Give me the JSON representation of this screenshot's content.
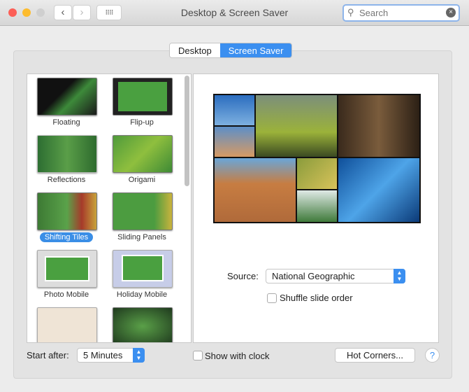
{
  "window": {
    "title": "Desktop & Screen Saver"
  },
  "search": {
    "placeholder": "Search"
  },
  "tabs": [
    {
      "label": "Desktop"
    },
    {
      "label": "Screen Saver"
    }
  ],
  "savers": [
    {
      "label": "Floating"
    },
    {
      "label": "Flip-up"
    },
    {
      "label": "Reflections"
    },
    {
      "label": "Origami"
    },
    {
      "label": "Shifting Tiles"
    },
    {
      "label": "Sliding Panels"
    },
    {
      "label": "Photo Mobile"
    },
    {
      "label": "Holiday Mobile"
    },
    {
      "label": ""
    },
    {
      "label": ""
    }
  ],
  "selected": "Shifting Tiles",
  "source": {
    "label": "Source:",
    "value": "National Geographic"
  },
  "shuffle": {
    "label": "Shuffle slide order",
    "checked": false
  },
  "start_after": {
    "label": "Start after:",
    "value": "5 Minutes"
  },
  "clock": {
    "label": "Show with clock",
    "checked": false
  },
  "hot_corners": "Hot Corners...",
  "help": "?",
  "colors": {
    "accent": "#3b8ff0"
  }
}
